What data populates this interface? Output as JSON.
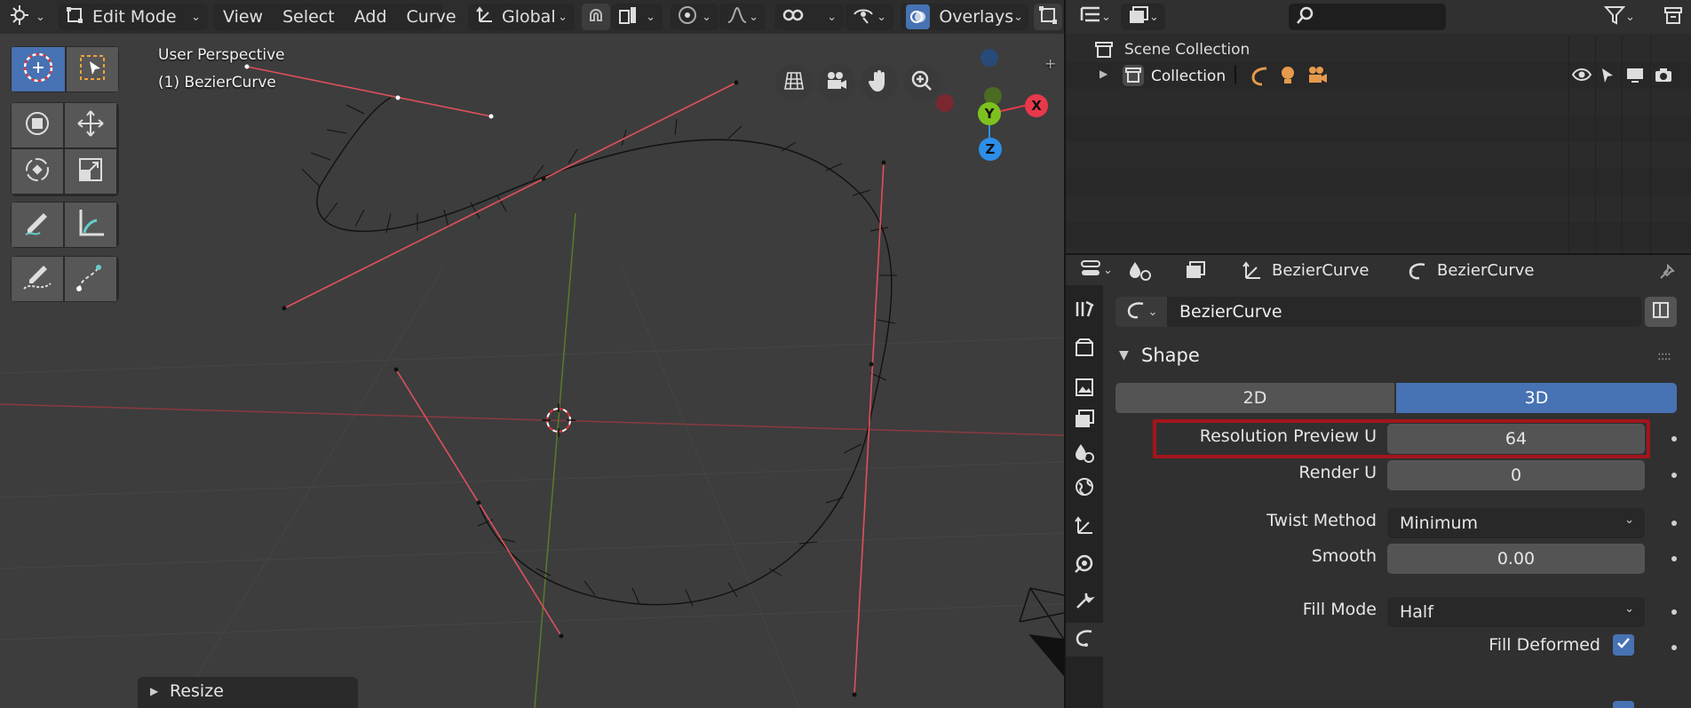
{
  "header": {
    "editor_type_icon": "3d-viewport-icon",
    "mode": "Edit Mode",
    "menus": [
      "View",
      "Select",
      "Add",
      "Curve"
    ],
    "transform_orientation": "Global",
    "overlays_label": "Overlays"
  },
  "viewport": {
    "perspective_label": "User Perspective",
    "object_label": "(1) BezierCurve",
    "gizmo": {
      "x": "X",
      "y": "Y",
      "z": "Z"
    },
    "last_operator": "Resize"
  },
  "outliner": {
    "search_placeholder": "",
    "scene_collection": "Scene Collection",
    "collection": "Collection"
  },
  "properties": {
    "breadcrumb": [
      "BezierCurve",
      "BezierCurve"
    ],
    "datablock_name": "BezierCurve",
    "panel_title": "Shape",
    "dimension_options": [
      "2D",
      "3D"
    ],
    "dimension_selected": "3D",
    "fields": {
      "resolution_preview_u": {
        "label": "Resolution Preview U",
        "value": "64"
      },
      "render_u": {
        "label": "Render U",
        "value": "0"
      },
      "twist_method": {
        "label": "Twist Method",
        "value": "Minimum"
      },
      "smooth": {
        "label": "Smooth",
        "value": "0.00"
      },
      "fill_mode": {
        "label": "Fill Mode",
        "value": "Half"
      },
      "fill_deformed": {
        "label": "Fill Deformed",
        "checked": true
      }
    },
    "highlight_color": "#a3151a"
  },
  "colors": {
    "accent": "#4772b3",
    "handle_line": "#e0505a",
    "x_axis": "#e8394b",
    "y_axis": "#7dc11e",
    "z_axis": "#2c8fea"
  }
}
